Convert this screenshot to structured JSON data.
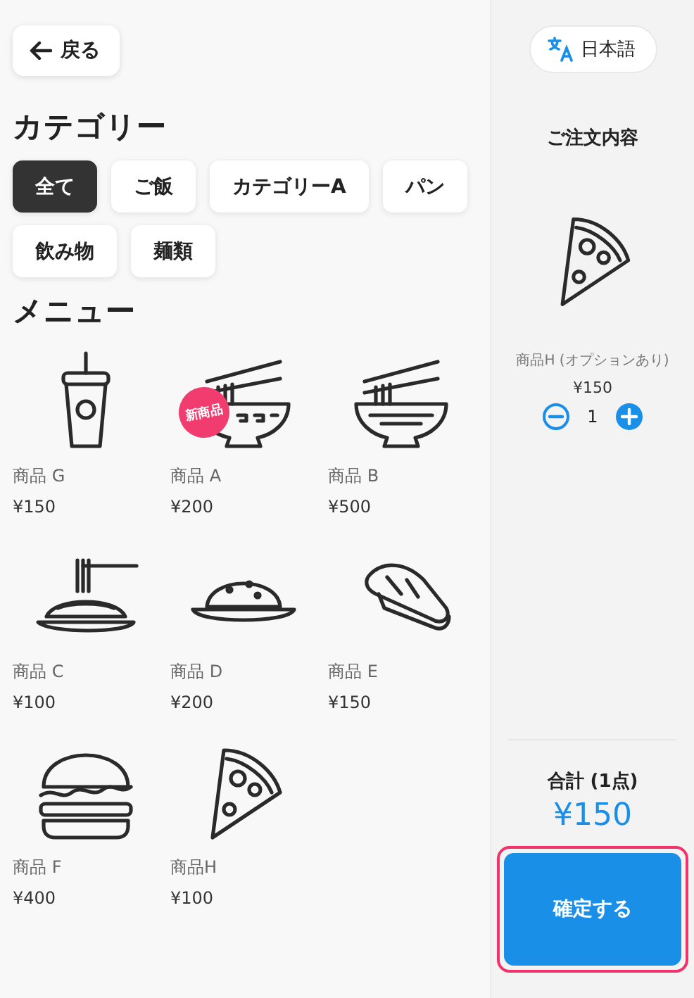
{
  "back_button": {
    "label": "戻る"
  },
  "categories": {
    "title": "カテゴリー",
    "items": [
      {
        "label": "全て",
        "selected": true
      },
      {
        "label": "ご飯",
        "selected": false
      },
      {
        "label": "カテゴリーA",
        "selected": false
      },
      {
        "label": "パン",
        "selected": false
      },
      {
        "label": "飲み物",
        "selected": false
      },
      {
        "label": "麺類",
        "selected": false
      }
    ]
  },
  "menu": {
    "title": "メニュー",
    "items": [
      {
        "name": "商品 G",
        "price": "¥150"
      },
      {
        "name": "商品 A",
        "price": "¥200",
        "badge": "新商品"
      },
      {
        "name": "商品 B",
        "price": "¥500"
      },
      {
        "name": "商品 C",
        "price": "¥100"
      },
      {
        "name": "商品 D",
        "price": "¥200"
      },
      {
        "name": "商品 E",
        "price": "¥150"
      },
      {
        "name": "商品 F",
        "price": "¥400"
      },
      {
        "name": "商品H",
        "price": "¥100"
      }
    ]
  },
  "order": {
    "language": "日本語",
    "title": "ご注文内容",
    "items": [
      {
        "name": "商品H (オプションあり)",
        "price": "¥150",
        "quantity": "1"
      }
    ],
    "total_label": "合計 (1点)",
    "total": "¥150",
    "confirm_button": {
      "label": "確定する",
      "highlighted": true
    }
  }
}
